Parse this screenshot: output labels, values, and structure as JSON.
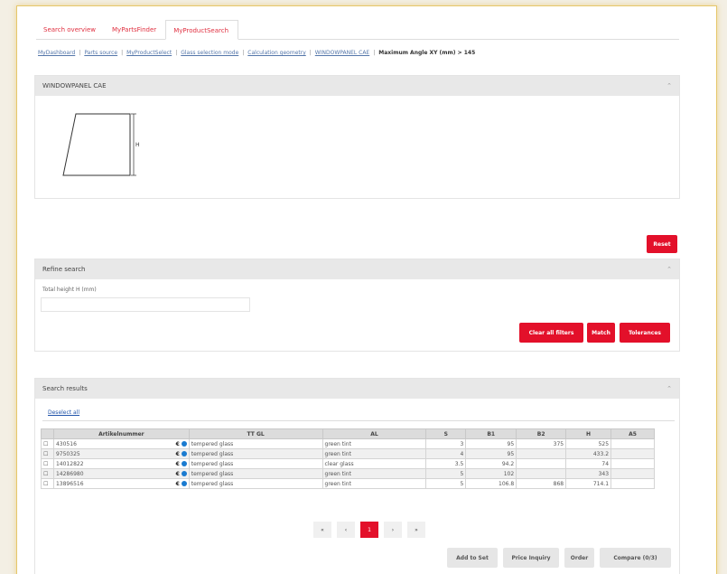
{
  "tabs": [
    {
      "label": "Search overview",
      "active": false
    },
    {
      "label": "MyPartsFinder",
      "active": false
    },
    {
      "label": "MyProductSearch",
      "active": true
    }
  ],
  "breadcrumbs": [
    {
      "label": "MyDashboard"
    },
    {
      "label": "Parts source"
    },
    {
      "label": "MyProductSelect"
    },
    {
      "label": "Glass selection mode"
    },
    {
      "label": "Calculation geometry"
    },
    {
      "label": "WINDOWPANEL CAE"
    },
    {
      "label": "Maximum Angle XY (mm) > 145",
      "current": true
    }
  ],
  "shape_panel": {
    "title": "WINDOWPANEL CAE",
    "dimension_label": "H"
  },
  "reset_label": "Reset",
  "refine": {
    "title": "Refine search",
    "field_label": "Total height H (mm)",
    "field_value": "",
    "clear_label": "Clear all filters",
    "match_label": "Match",
    "tolerances_label": "Tolerances"
  },
  "results": {
    "title": "Search results",
    "deselect_label": "Deselect all",
    "columns": [
      "Artikelnummer",
      "TT GL",
      "AL",
      "S",
      "B1",
      "B2",
      "H",
      "A5"
    ],
    "rows": [
      {
        "id": "430516",
        "glass": "tempered glass",
        "color": "green tint",
        "s": "3",
        "b1": "95",
        "b2": "375",
        "h": "525",
        "a5": ""
      },
      {
        "id": "9750325",
        "glass": "tempered glass",
        "color": "green tint",
        "s": "4",
        "b1": "95",
        "b2": "",
        "h": "433.2",
        "a5": ""
      },
      {
        "id": "14012822",
        "glass": "tempered glass",
        "color": "clear glass",
        "s": "3.5",
        "b1": "94.2",
        "b2": "",
        "h": "74",
        "a5": ""
      },
      {
        "id": "14286980",
        "glass": "tempered glass",
        "color": "green tint",
        "s": "5",
        "b1": "102",
        "b2": "",
        "h": "343",
        "a5": ""
      },
      {
        "id": "13896516",
        "glass": "tempered glass",
        "color": "green tint",
        "s": "5",
        "b1": "106.8",
        "b2": "868",
        "h": "714.1",
        "a5": ""
      }
    ],
    "pager": {
      "first": "«",
      "prev": "‹",
      "current": "1",
      "next": "›",
      "last": "»"
    }
  },
  "actions": {
    "add_to_set": "Add to Set",
    "price_inquiry": "Price Inquiry",
    "order": "Order",
    "compare": "Compare (0/3)"
  },
  "colors": {
    "accent": "#e3102a",
    "info": "#1a7bd0",
    "frame": "#e6c76a"
  }
}
